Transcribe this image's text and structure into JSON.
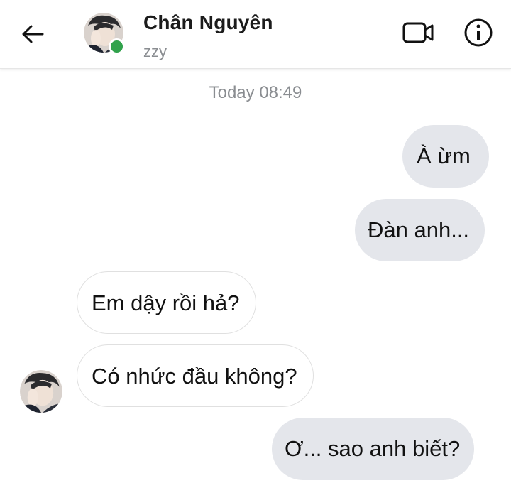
{
  "header": {
    "contact_name": "Chân Nguyên",
    "status": "zzy",
    "online": true,
    "icons": {
      "back": "arrow-left-icon",
      "video": "video-camera-icon",
      "info": "info-icon"
    }
  },
  "timestamp": "Today 08:49",
  "messages": [
    {
      "sender": "me",
      "text": "À ừm"
    },
    {
      "sender": "me",
      "text": "Đàn anh..."
    },
    {
      "sender": "them",
      "text": "Em dậy rồi hả?"
    },
    {
      "sender": "them",
      "text": "Có nhức đầu không?"
    },
    {
      "sender": "me",
      "text": "Ơ... sao anh biết?"
    }
  ],
  "colors": {
    "online_dot": "#31a24c",
    "my_bubble": "#e4e6eb",
    "their_bubble": "#ffffff",
    "muted_text": "#8a8d91"
  }
}
